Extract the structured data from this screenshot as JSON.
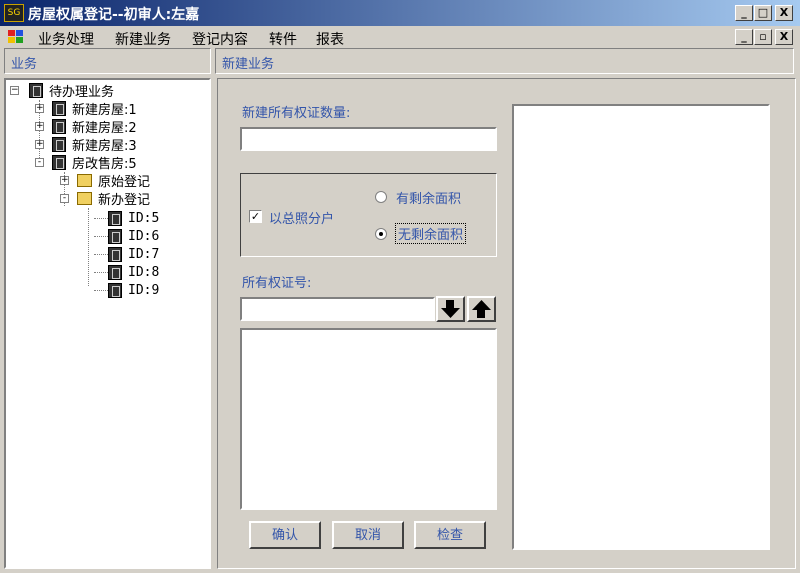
{
  "window": {
    "title": "房屋权属登记--初审人:左嘉",
    "app_icon_text": "SG"
  },
  "window_controls": {
    "minimize": "_",
    "maximize": "□",
    "close": "X",
    "restore": "▫"
  },
  "menu": {
    "items": [
      "业务处理",
      "新建业务",
      "登记内容",
      "转件",
      "报表"
    ]
  },
  "left_panel": {
    "header": "业务"
  },
  "right_panel": {
    "header": "新建业务"
  },
  "tree": {
    "root": "待办理业务",
    "nodes": [
      {
        "label": "新建房屋:1",
        "expander": "+"
      },
      {
        "label": "新建房屋:2",
        "expander": "+"
      },
      {
        "label": "新建房屋:3",
        "expander": "+"
      },
      {
        "label": "房改售房:5",
        "expander": "-"
      },
      {
        "label": "原始登记",
        "expander": "+"
      },
      {
        "label": "新办登记",
        "expander": "-"
      },
      {
        "label": "ID:5"
      },
      {
        "label": "ID:6"
      },
      {
        "label": "ID:7"
      },
      {
        "label": "ID:8"
      },
      {
        "label": "ID:9"
      }
    ]
  },
  "form": {
    "count_label": "新建所有权证数量:",
    "count_value": "",
    "checkbox_label": "以总照分户",
    "checkbox_checked": true,
    "radio_with_remaining": "有剩余面积",
    "radio_no_remaining": "无剩余面积",
    "selected_radio": "无剩余面积",
    "cert_label": "所有权证号:",
    "cert_value": "",
    "buttons": {
      "confirm": "确认",
      "cancel": "取消",
      "check": "检查"
    }
  },
  "colors": {
    "title_start": "#0a246a",
    "title_end": "#a6caf0",
    "label_blue": "#3355aa",
    "face": "#d4d0c8"
  }
}
